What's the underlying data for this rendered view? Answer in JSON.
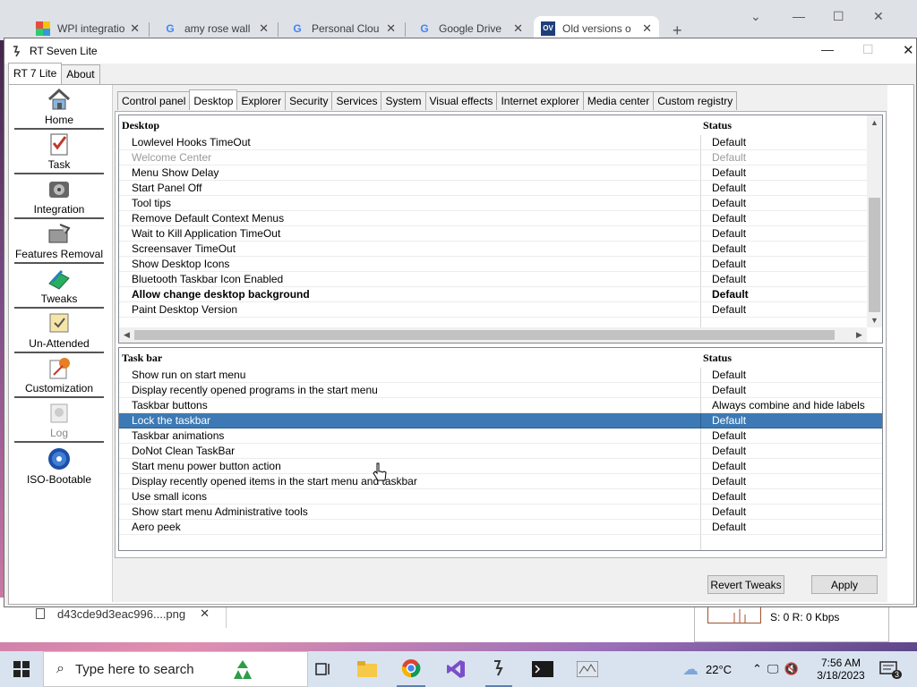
{
  "browser": {
    "tabs": [
      {
        "title": "WPI integratio"
      },
      {
        "title": "amy rose wall"
      },
      {
        "title": "Personal Clou"
      },
      {
        "title": "Google Drive"
      },
      {
        "title": "Old versions o"
      }
    ],
    "new_tab": "+",
    "minimize": "—",
    "maximize": "☐",
    "close": "✕",
    "tab_list": "⌄"
  },
  "download": {
    "file": "d43cde9d3eac996....png",
    "dismiss": "✕"
  },
  "net_widget": {
    "text": "S: 0  R: 0 Kbps"
  },
  "app": {
    "title": "RT Seven Lite",
    "tabs": [
      {
        "label": "RT 7 Lite"
      },
      {
        "label": "About"
      }
    ],
    "nav": [
      {
        "label": "Home"
      },
      {
        "label": "Task"
      },
      {
        "label": "Integration"
      },
      {
        "label": "Features Removal"
      },
      {
        "label": "Tweaks"
      },
      {
        "label": "Un-Attended"
      },
      {
        "label": "Customization"
      },
      {
        "label": "Log"
      },
      {
        "label": "ISO-Bootable"
      }
    ],
    "subtabs": [
      {
        "label": "Control panel"
      },
      {
        "label": "Desktop"
      },
      {
        "label": "Explorer"
      },
      {
        "label": "Security"
      },
      {
        "label": "Services"
      },
      {
        "label": "System"
      },
      {
        "label": "Visual effects"
      },
      {
        "label": "Internet explorer"
      },
      {
        "label": "Media center"
      },
      {
        "label": "Custom registry"
      }
    ],
    "desktop_grid": {
      "col1": "Desktop",
      "col2": "Status",
      "rows": [
        {
          "name": "Lowlevel Hooks TimeOut",
          "status": "Default"
        },
        {
          "name": "Welcome Center",
          "status": "Default"
        },
        {
          "name": "Menu Show Delay",
          "status": "Default"
        },
        {
          "name": "Start Panel Off",
          "status": "Default"
        },
        {
          "name": "Tool tips",
          "status": "Default"
        },
        {
          "name": "Remove Default Context Menus",
          "status": "Default"
        },
        {
          "name": "Wait to Kill Application TimeOut",
          "status": "Default"
        },
        {
          "name": "Screensaver TimeOut",
          "status": "Default"
        },
        {
          "name": "Show Desktop Icons",
          "status": "Default"
        },
        {
          "name": "Bluetooth Taskbar Icon Enabled",
          "status": "Default"
        },
        {
          "name": "Allow change desktop background",
          "status": "Default"
        },
        {
          "name": "Paint Desktop Version",
          "status": "Default"
        }
      ]
    },
    "taskbar_grid": {
      "col1": "Task bar",
      "col2": "Status",
      "rows": [
        {
          "name": "Show run on start menu",
          "status": "Default"
        },
        {
          "name": "Display recently opened programs in the start menu",
          "status": "Default"
        },
        {
          "name": "Taskbar buttons",
          "status": "Always combine and hide labels"
        },
        {
          "name": "Lock the taskbar",
          "status": "Default"
        },
        {
          "name": "Taskbar animations",
          "status": "Default"
        },
        {
          "name": "DoNot Clean TaskBar",
          "status": "Default"
        },
        {
          "name": "Start menu power button action",
          "status": "Default"
        },
        {
          "name": "Display recently opened items in the start menu and taskbar",
          "status": "Default"
        },
        {
          "name": "Use small icons",
          "status": "Default"
        },
        {
          "name": "Show start menu Administrative tools",
          "status": "Default"
        },
        {
          "name": "Aero peek",
          "status": "Default"
        }
      ]
    },
    "buttons": {
      "revert": "Revert Tweaks",
      "apply": "Apply"
    }
  },
  "taskbar": {
    "search_placeholder": "Type here to search",
    "weather": "22°C",
    "time": "7:56 AM",
    "date": "3/18/2023",
    "notifications": "3"
  }
}
